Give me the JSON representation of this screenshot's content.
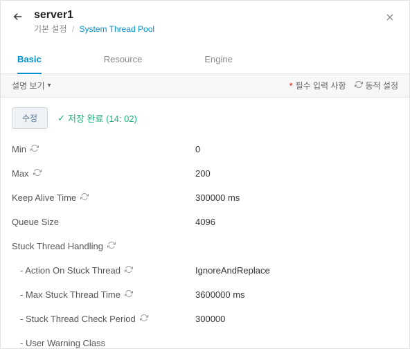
{
  "header": {
    "title": "server1",
    "breadcrumb_root": "기본 설정",
    "breadcrumb_current": "System Thread Pool"
  },
  "tabs": {
    "basic": "Basic",
    "resource": "Resource",
    "engine": "Engine"
  },
  "toolbar": {
    "desc_toggle": "설명 보기",
    "required_label": "필수 입력 사항",
    "dynamic_label": "동적 설정"
  },
  "actions": {
    "edit": "수정",
    "saved": "저장 완료 (14: 02)"
  },
  "fields": {
    "min": {
      "label": "Min",
      "value": "0"
    },
    "max": {
      "label": "Max",
      "value": "200"
    },
    "keepalive": {
      "label": "Keep Alive Time",
      "value": "300000 ms"
    },
    "queue": {
      "label": "Queue Size",
      "value": "4096"
    },
    "stuck_heading": "Stuck Thread Handling",
    "action_stuck": {
      "label": "- Action On Stuck Thread",
      "value": "IgnoreAndReplace"
    },
    "max_stuck": {
      "label": "- Max Stuck Thread Time",
      "value": "3600000 ms"
    },
    "check_period": {
      "label": "- Stuck Thread Check Period",
      "value": "300000"
    },
    "user_warn": {
      "label": "- User Warning Class",
      "value": ""
    }
  }
}
